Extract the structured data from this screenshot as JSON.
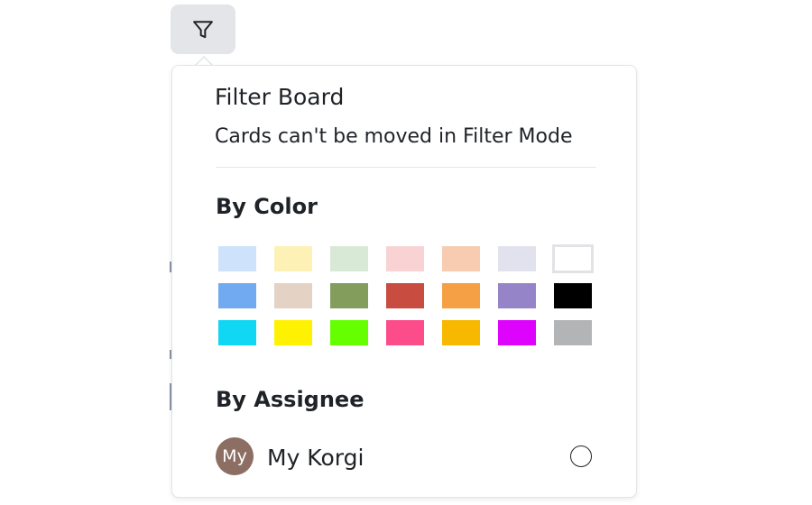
{
  "toolbar": {
    "filter_icon": "filter-funnel-icon"
  },
  "filter_panel": {
    "title": "Filter Board",
    "subtitle": "Cards can't be moved in Filter Mode",
    "by_color": {
      "heading": "By Color",
      "swatches": [
        {
          "name": "light-blue",
          "color": "#cfe2fb",
          "selected": false
        },
        {
          "name": "light-yellow",
          "color": "#fdf1b6",
          "selected": false
        },
        {
          "name": "light-green",
          "color": "#d8e9d6",
          "selected": false
        },
        {
          "name": "light-pink",
          "color": "#f9d3d3",
          "selected": false
        },
        {
          "name": "light-peach",
          "color": "#f8ccb0",
          "selected": false
        },
        {
          "name": "light-lavender",
          "color": "#e2e1ee",
          "selected": false
        },
        {
          "name": "white",
          "color": "#ffffff",
          "selected": false
        },
        {
          "name": "blue",
          "color": "#71aaf0",
          "selected": false
        },
        {
          "name": "beige",
          "color": "#e4d2c4",
          "selected": false
        },
        {
          "name": "olive-green",
          "color": "#839e5c",
          "selected": false
        },
        {
          "name": "red",
          "color": "#c84c40",
          "selected": false
        },
        {
          "name": "orange",
          "color": "#f6a046",
          "selected": false
        },
        {
          "name": "purple",
          "color": "#9585c8",
          "selected": false
        },
        {
          "name": "black",
          "color": "#000000",
          "selected": false
        },
        {
          "name": "cyan",
          "color": "#10d8f4",
          "selected": false
        },
        {
          "name": "yellow",
          "color": "#fef102",
          "selected": false
        },
        {
          "name": "lime",
          "color": "#66ff00",
          "selected": false
        },
        {
          "name": "hot-pink",
          "color": "#fd4c8a",
          "selected": false
        },
        {
          "name": "amber",
          "color": "#f8b800",
          "selected": false
        },
        {
          "name": "magenta",
          "color": "#dd03fc",
          "selected": false
        },
        {
          "name": "gray",
          "color": "#b2b4b6",
          "selected": false
        }
      ]
    },
    "by_assignee": {
      "heading": "By Assignee",
      "assignees": [
        {
          "initials": "My",
          "name": "My Korgi",
          "avatar_color": "#8d6e63",
          "selected": false
        }
      ]
    }
  }
}
